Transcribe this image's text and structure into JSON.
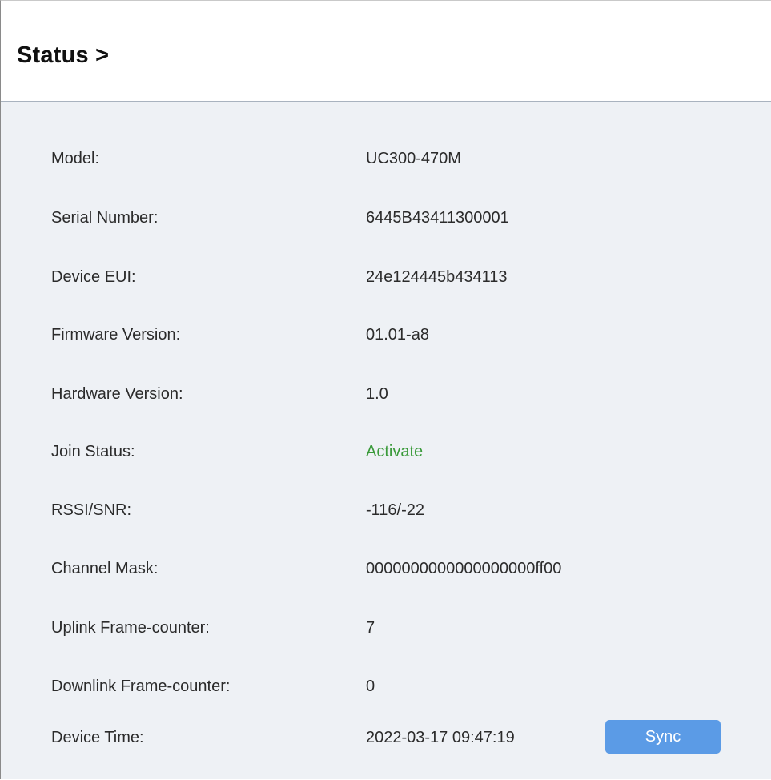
{
  "header": {
    "title": "Status >"
  },
  "status": {
    "model": {
      "label": "Model:",
      "value": "UC300-470M"
    },
    "serial_number": {
      "label": "Serial Number:",
      "value": "6445B43411300001"
    },
    "device_eui": {
      "label": "Device EUI:",
      "value": "24e124445b434113"
    },
    "firmware_version": {
      "label": "Firmware Version:",
      "value": "01.01-a8"
    },
    "hardware_version": {
      "label": "Hardware Version:",
      "value": "1.0"
    },
    "join_status": {
      "label": "Join Status:",
      "value": "Activate",
      "color": "#3a9a3a"
    },
    "rssi_snr": {
      "label": "RSSI/SNR:",
      "value": "-116/-22"
    },
    "channel_mask": {
      "label": "Channel Mask:",
      "value": "0000000000000000000ff00"
    },
    "uplink_frame_counter": {
      "label": "Uplink Frame-counter:",
      "value": "7"
    },
    "downlink_frame_counter": {
      "label": "Downlink Frame-counter:",
      "value": "0"
    },
    "device_time": {
      "label": "Device Time:",
      "value": "2022-03-17 09:47:19",
      "sync_label": "Sync"
    }
  },
  "colors": {
    "background": "#eef1f5",
    "accent_button": "#5b9be6",
    "status_ok": "#3a9a3a"
  }
}
